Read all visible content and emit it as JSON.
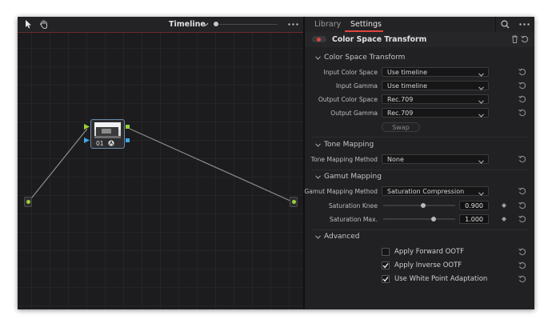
{
  "node_editor": {
    "title": "Timeline",
    "node": {
      "label": "01"
    }
  },
  "panel": {
    "tabs": [
      {
        "label": "Library"
      },
      {
        "label": "Settings"
      }
    ],
    "active_tab": "Settings",
    "effect_title": "Color Space Transform"
  },
  "sections": {
    "cst": {
      "title": "Color Space Transform",
      "input_color_space": {
        "label": "Input Color Space",
        "value": "Use timeline"
      },
      "input_gamma": {
        "label": "Input Gamma",
        "value": "Use timeline"
      },
      "output_color_space": {
        "label": "Output Color Space",
        "value": "Rec.709"
      },
      "output_gamma": {
        "label": "Output Gamma",
        "value": "Rec.709"
      },
      "swap_label": "Swap"
    },
    "tone": {
      "title": "Tone Mapping",
      "method": {
        "label": "Tone Mapping Method",
        "value": "None"
      }
    },
    "gamut": {
      "title": "Gamut Mapping",
      "method": {
        "label": "Gamut Mapping Method",
        "value": "Saturation Compression"
      },
      "knee": {
        "label": "Saturation Knee",
        "value": "0.900",
        "fraction": 0.55
      },
      "max": {
        "label": "Saturation Max.",
        "value": "1.000",
        "fraction": 0.7
      }
    },
    "advanced": {
      "title": "Advanced",
      "options": [
        {
          "label": "Apply Forward OOTF",
          "checked": false
        },
        {
          "label": "Apply Inverse OOTF",
          "checked": true
        },
        {
          "label": "Use White Point Adaptation",
          "checked": true
        }
      ]
    }
  },
  "colors": {
    "accent_red": "#e0463c",
    "node_green": "#9ad03a",
    "node_blue": "#3fa6e8"
  }
}
